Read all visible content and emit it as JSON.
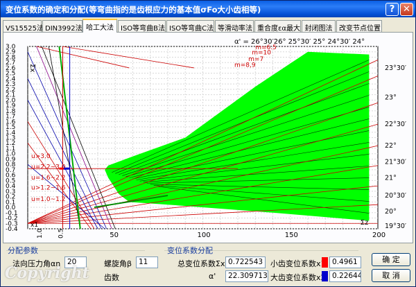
{
  "window": {
    "title": "变位系数的确定和分配(等弯曲指的是齿根应力的基本值σFo大小齿相等)"
  },
  "tabs": [
    {
      "label": "VS15525法"
    },
    {
      "label": "DIN3992法"
    },
    {
      "label": "哈工大法",
      "active": true
    },
    {
      "label": "ISO等弯曲B法"
    },
    {
      "label": "ISO等弯曲C法"
    },
    {
      "label": "等滑动率法"
    },
    {
      "label": "重合度εα最大"
    },
    {
      "label": "封闭图法"
    },
    {
      "label": "改变节点位置"
    }
  ],
  "chart_data": {
    "type": "line",
    "title": "",
    "xlabel": "Σz",
    "ylabel": "Σx",
    "xlim": [
      0,
      200
    ],
    "ylim": [
      -0.4,
      3.0
    ],
    "x_ticks": [
      "50",
      "100",
      "150",
      "200"
    ],
    "y_ticks": [
      "3.0",
      "2.9",
      "2.8",
      "2.7",
      "2.6",
      "2.5",
      "2.4",
      "2.3",
      "2.2",
      "2.1",
      "2.0",
      "1.9",
      "1.8",
      "1.7",
      "1.6",
      "1.5",
      "1.4",
      "1.3",
      "1.2",
      "1.1",
      "1.0",
      "0.9",
      "0.8",
      "0.7",
      "0.6",
      "0.5",
      "0.4",
      "0.3",
      "0.2",
      "0.1",
      "0.0",
      "-0.1",
      "-0.2",
      "-0.3",
      "-0.4"
    ],
    "x1_axis_label": "x1",
    "x1_ticks": [
      "1.0",
      "0.5"
    ],
    "top_label": "α' = 26°30′26° 25°30′ 25° 24°30′ 24°",
    "right_labels": [
      "23°30′",
      "23°",
      "22°30′",
      "22°",
      "21°30′",
      "21°",
      "20°30′",
      "20°",
      "19°30′"
    ],
    "m_labels": [
      "m=6.5",
      "m=10",
      "m=7",
      "m=8,9"
    ],
    "u_labels": [
      "u>3.0",
      "u=2.2~3.0",
      "u=1.6~2.2",
      "u>1.2~1.6",
      "u=1.0~1.2"
    ],
    "green_region_color": "#00ff00",
    "selected_point": {
      "sum_z": 20,
      "sum_x": 0.7225
    }
  },
  "params": {
    "section_title": "分配参数",
    "pressure_angle_label": "法向压力角αn",
    "pressure_angle_value": "20",
    "helix_angle_label": "螺旋角β",
    "helix_angle_value": "11",
    "gear_label": "齿数"
  },
  "shift": {
    "section_title": "变位系数分配",
    "total_label": "总变位系数Σx",
    "total_value": "0.722543",
    "angle_value": "22.30971346",
    "small_label": "小齿变位系数x1",
    "small_value": "0.4961",
    "small_color": "#ff0000",
    "large_label": "大齿变位系数x2",
    "large_value": "0.226443",
    "large_color": "#0000cc"
  },
  "buttons": {
    "ok": "确 定",
    "cancel": "取 消"
  },
  "watermark": "Copyright"
}
